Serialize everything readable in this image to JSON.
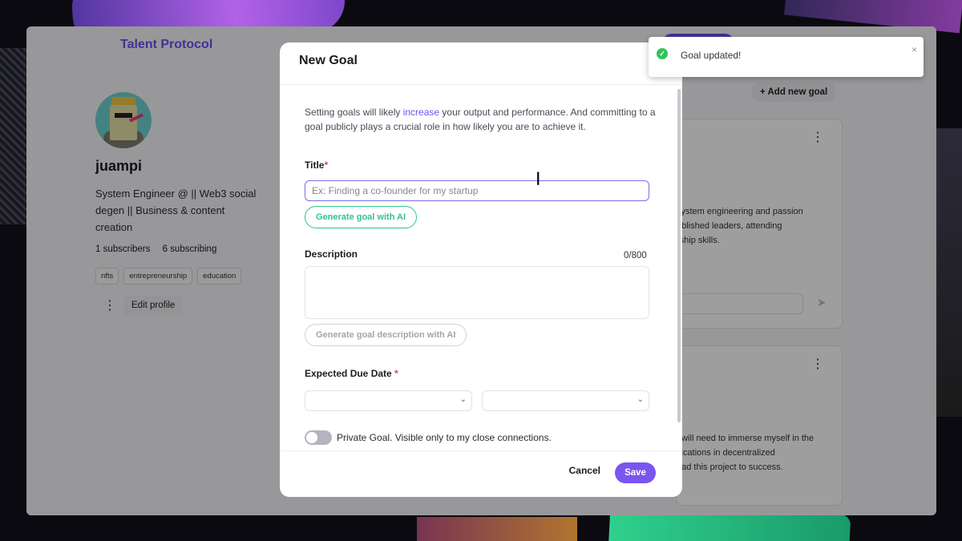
{
  "app": {
    "logo": "Talent Protocol"
  },
  "profile": {
    "username": "juampi",
    "bio": "System Engineer @ || Web3 social degen || Business & content creation",
    "subscribers": "1 subscribers",
    "subscribing": "6 subscribing",
    "tags": [
      "nfts",
      "entrepreneurship",
      "education"
    ],
    "edit_label": "Edit profile"
  },
  "goals_page": {
    "add_goal_label": "Add new goal",
    "card1_text": "system engineering and passion\nablished leaders, attending\nrship skills.",
    "card2_text": "I will need to immerse myself in the\nifications in decentralized\nead this project to success."
  },
  "modal": {
    "title": "New Goal",
    "intro_before": "Setting goals will likely ",
    "intro_link": "increase",
    "intro_after": " your output and performance. And committing to a goal publicly plays a crucial role in how likely you are to achieve it.",
    "title_label": "Title",
    "required_mark": "*",
    "title_placeholder": "Ex: Finding a co-founder for my startup",
    "generate_goal_label": "Generate goal with AI",
    "description_label": "Description",
    "description_counter": "0/800",
    "generate_description_label": "Generate goal description with AI",
    "due_date_label": "Expected Due Date",
    "private_label": "Private Goal. Visible only to my close connections.",
    "cancel_label": "Cancel",
    "save_label": "Save"
  },
  "toast": {
    "message": "Goal updated!",
    "close": "×"
  },
  "icons": {
    "check": "check-circle-icon",
    "close": "close-icon",
    "plus": "plus-icon",
    "kebab": "kebab-menu-icon",
    "chevron": "chevron-down-icon",
    "send": "send-icon",
    "cursor": "text-cursor-icon"
  },
  "colors": {
    "accent": "#6d4ff0",
    "ai_green": "#2fc48a",
    "success": "#2fc45a",
    "required": "#e0405a"
  }
}
